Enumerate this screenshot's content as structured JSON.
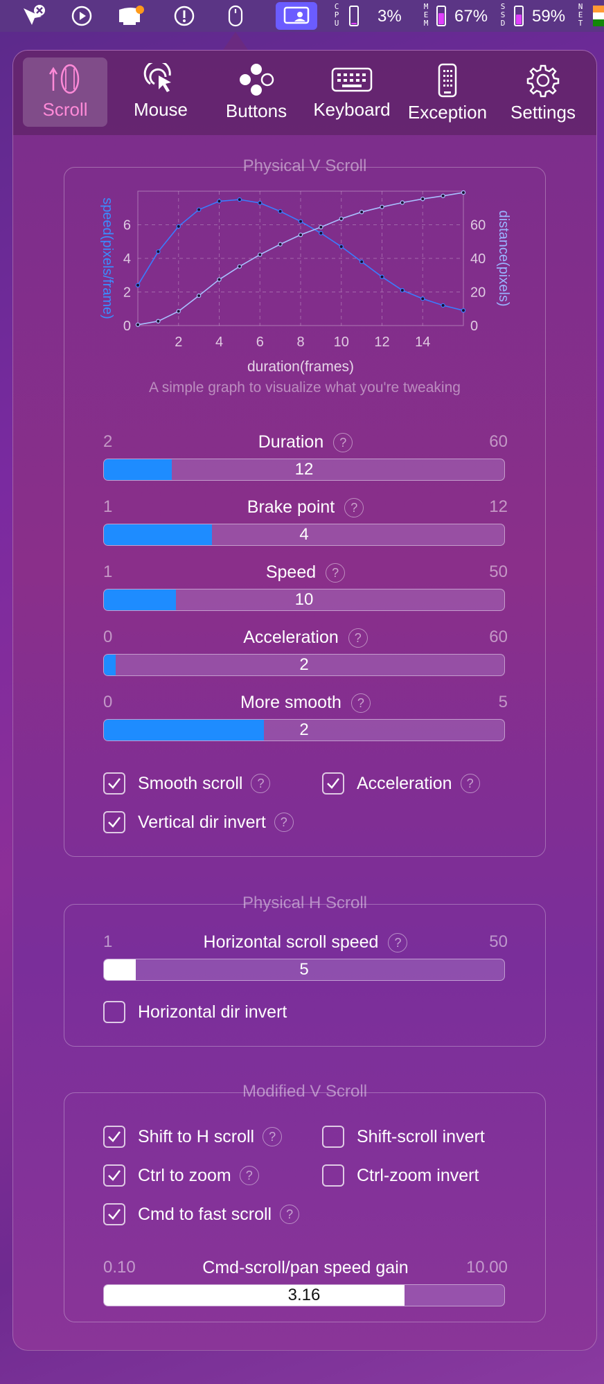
{
  "menubar": {
    "cpu_label": [
      "C",
      "P",
      "U"
    ],
    "cpu_value": "3%",
    "cpu_fill": 0.03,
    "mem_label": [
      "M",
      "E",
      "M"
    ],
    "mem_value": "67%",
    "mem_fill": 0.67,
    "ssd_label": [
      "S",
      "S",
      "D"
    ],
    "ssd_value": "59%",
    "ssd_fill": 0.59,
    "net_label": [
      "N",
      "E",
      "T"
    ],
    "icons": [
      "app-x-icon",
      "play-icon",
      "notification-icon",
      "alert-icon",
      "mouse-icon",
      "screen-share-icon"
    ]
  },
  "tabs": [
    {
      "label": "Scroll",
      "icon": "scroll-icon",
      "active": true
    },
    {
      "label": "Mouse",
      "icon": "mouse-cursor-icon",
      "active": false
    },
    {
      "label": "Buttons",
      "icon": "buttons-icon",
      "active": false
    },
    {
      "label": "Keyboard",
      "icon": "keyboard-icon",
      "active": false
    },
    {
      "label": "Exception",
      "icon": "phone-icon",
      "active": false
    },
    {
      "label": "Settings",
      "icon": "gear-icon",
      "active": false
    }
  ],
  "physical_v": {
    "title": "Physical V Scroll",
    "chart_caption": "A simple graph to visualize what you're tweaking",
    "sliders": [
      {
        "label": "Duration",
        "min": "2",
        "max": "60",
        "value": "12",
        "fill": 0.17
      },
      {
        "label": "Brake point",
        "min": "1",
        "max": "12",
        "value": "4",
        "fill": 0.27
      },
      {
        "label": "Speed",
        "min": "1",
        "max": "50",
        "value": "10",
        "fill": 0.18
      },
      {
        "label": "Acceleration",
        "min": "0",
        "max": "60",
        "value": "2",
        "fill": 0.03
      },
      {
        "label": "More smooth",
        "min": "0",
        "max": "5",
        "value": "2",
        "fill": 0.4
      }
    ],
    "checks": {
      "smooth_scroll": "Smooth scroll",
      "acceleration": "Acceleration",
      "vertical_invert": "Vertical dir invert"
    }
  },
  "physical_h": {
    "title": "Physical H Scroll",
    "slider": {
      "label": "Horizontal scroll speed",
      "min": "1",
      "max": "50",
      "value": "5",
      "fill": 0.08
    },
    "check_invert": "Horizontal dir invert"
  },
  "modified_v": {
    "title": "Modified V Scroll",
    "checks": {
      "shift_h": "Shift to H scroll",
      "shift_invert": "Shift-scroll invert",
      "ctrl_zoom": "Ctrl to zoom",
      "ctrl_invert": "Ctrl-zoom invert",
      "cmd_fast": "Cmd to fast scroll"
    },
    "gain": {
      "label": "Cmd-scroll/pan speed gain",
      "min": "0.10",
      "max": "10.00",
      "value": "3.16",
      "fill": 0.75
    }
  },
  "chart_data": {
    "type": "line",
    "xlabel": "duration(frames)",
    "ylabel_left": "speed(pixels/frame)",
    "ylabel_right": "distance(pixels)",
    "xlim": [
      0,
      16
    ],
    "ylim_left": [
      0,
      8
    ],
    "ylim_right": [
      0,
      80
    ],
    "x_ticks": [
      "2",
      "4",
      "6",
      "8",
      "10",
      "12",
      "14"
    ],
    "y_left_ticks": [
      "0",
      "2",
      "4",
      "6"
    ],
    "y_right_ticks": [
      "0",
      "20",
      "40",
      "60"
    ],
    "grid": true,
    "x": [
      0,
      1,
      2,
      3,
      4,
      5,
      6,
      7,
      8,
      9,
      10,
      11,
      12,
      13,
      14,
      15,
      16
    ],
    "series": [
      {
        "axis": "left",
        "values": [
          2.4,
          4.4,
          5.9,
          6.9,
          7.4,
          7.5,
          7.3,
          6.8,
          6.2,
          5.5,
          4.7,
          3.8,
          2.9,
          2.1,
          1.6,
          1.2,
          0.9
        ]
      },
      {
        "axis": "right",
        "values": [
          0.5,
          2.6,
          8.5,
          17.8,
          27.4,
          35.2,
          42.2,
          48.4,
          54.0,
          58.6,
          63.6,
          67.6,
          70.6,
          73.2,
          75.4,
          77.2,
          79.2
        ]
      }
    ]
  }
}
